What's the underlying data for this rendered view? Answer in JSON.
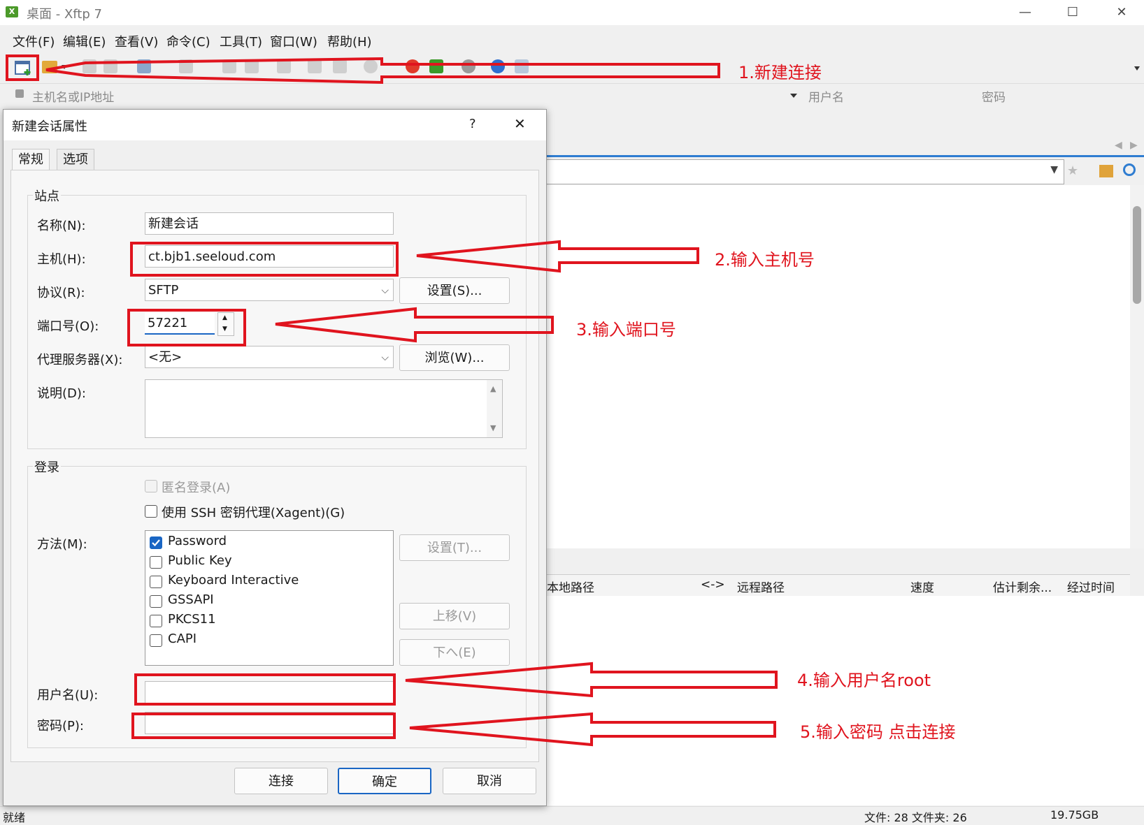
{
  "window": {
    "title": "桌面 - Xftp 7",
    "app_icon_text": "X",
    "minimize": "—",
    "maximize": "☐",
    "close": "✕"
  },
  "menu": [
    "文件(F)",
    "编辑(E)",
    "查看(V)",
    "命令(C)",
    "工具(T)",
    "窗口(W)",
    "帮助(H)"
  ],
  "address": {
    "host_placeholder": "主机名或IP地址",
    "user_placeholder": "用户名",
    "password_placeholder": "密码"
  },
  "transfer_columns": [
    "本地路径",
    "<->",
    "远程路径",
    "速度",
    "估计剩余...",
    "经过时间"
  ],
  "status": {
    "left": "就绪",
    "counts": "文件: 28  文件夹: 26",
    "size": "19.75GB"
  },
  "dialog": {
    "title": "新建会话属性",
    "help": "?",
    "close": "✕",
    "tabs": [
      "常规",
      "选项"
    ],
    "site_group": "站点",
    "name_label": "名称(N):",
    "name_value": "新建会话",
    "host_label": "主机(H):",
    "host_value": "ct.bjb1.seeloud.com",
    "protocol_label": "协议(R):",
    "protocol_value": "SFTP",
    "protocol_settings": "设置(S)...",
    "port_label": "端口号(O):",
    "port_value": "57221",
    "proxy_label": "代理服务器(X):",
    "proxy_value": "<无>",
    "proxy_browse": "浏览(W)...",
    "desc_label": "说明(D):",
    "login_group": "登录",
    "anonymous": "匿名登录(A)",
    "ssh_agent": "使用 SSH 密钥代理(Xagent)(G)",
    "method_label": "方法(M):",
    "methods": [
      {
        "name": "Password",
        "checked": true
      },
      {
        "name": "Public Key",
        "checked": false
      },
      {
        "name": "Keyboard Interactive",
        "checked": false
      },
      {
        "name": "GSSAPI",
        "checked": false
      },
      {
        "name": "PKCS11",
        "checked": false
      },
      {
        "name": "CAPI",
        "checked": false
      }
    ],
    "method_settings": "设置(T)...",
    "move_up": "上移(V)",
    "move_down": "下へ(E)",
    "user_label": "用户名(U):",
    "user_value": "",
    "password_label": "密码(P):",
    "password_value": "",
    "connect": "连接",
    "ok": "确定",
    "cancel": "取消"
  },
  "annotations": {
    "a1": "1.新建连接",
    "a2": "2.输入主机号",
    "a3": "3.输入端口号",
    "a4": "4.输入用户名root",
    "a5": "5.输入密码 点击连接"
  },
  "colors": {
    "annotation_red": "#e0141e",
    "checkbox_blue": "#1a66c4"
  }
}
